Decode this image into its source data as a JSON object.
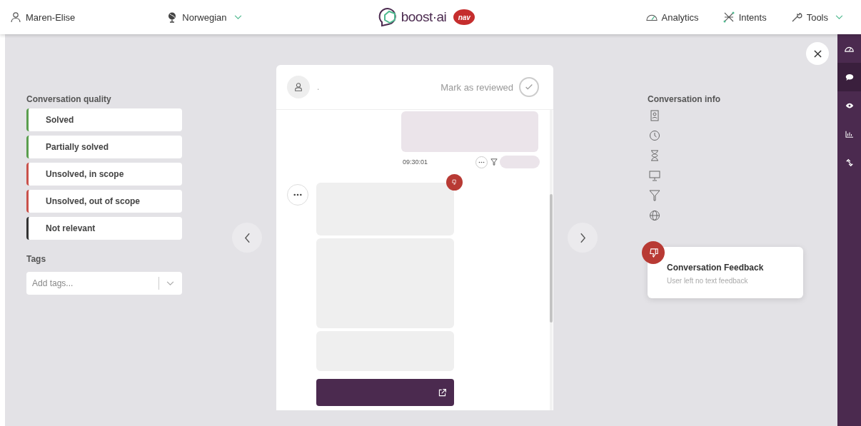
{
  "header": {
    "user": "Maren-Elise",
    "language": "Norwegian",
    "logo": "boost·ai",
    "partner": "nav",
    "nav": [
      {
        "kind": "analytics",
        "label": "Analytics"
      },
      {
        "kind": "intents",
        "label": "Intents"
      },
      {
        "kind": "tools",
        "label": "Tools"
      }
    ]
  },
  "quality": {
    "title": "Conversation quality",
    "options": [
      {
        "label": "Solved",
        "color": "#5a9e4e"
      },
      {
        "label": "Partially solved",
        "color": "#5a9e4e"
      },
      {
        "label": "Unsolved, in scope",
        "color": "#c9514b"
      },
      {
        "label": "Unsolved, out of scope",
        "color": "#c9514b"
      },
      {
        "label": "Not relevant",
        "color": "#333333"
      }
    ]
  },
  "tags": {
    "title": "Tags",
    "placeholder": "Add tags..."
  },
  "chat": {
    "user": ".",
    "mark_reviewed": "Mark as reviewed",
    "time": "09:30:01"
  },
  "info": {
    "title": "Conversation info",
    "icons": [
      {
        "kind": "contact"
      },
      {
        "kind": "clock"
      },
      {
        "kind": "hourglass"
      },
      {
        "kind": "monitor"
      },
      {
        "kind": "filter"
      },
      {
        "kind": "globe"
      }
    ]
  },
  "feedback": {
    "title": "Conversation Feedback",
    "text": "User left no text feedback"
  },
  "rail": [
    {
      "kind": "gauge",
      "selected": false
    },
    {
      "kind": "chat",
      "selected": true
    },
    {
      "kind": "eye",
      "selected": false
    },
    {
      "kind": "chart",
      "selected": false
    },
    {
      "kind": "link",
      "selected": false
    }
  ]
}
